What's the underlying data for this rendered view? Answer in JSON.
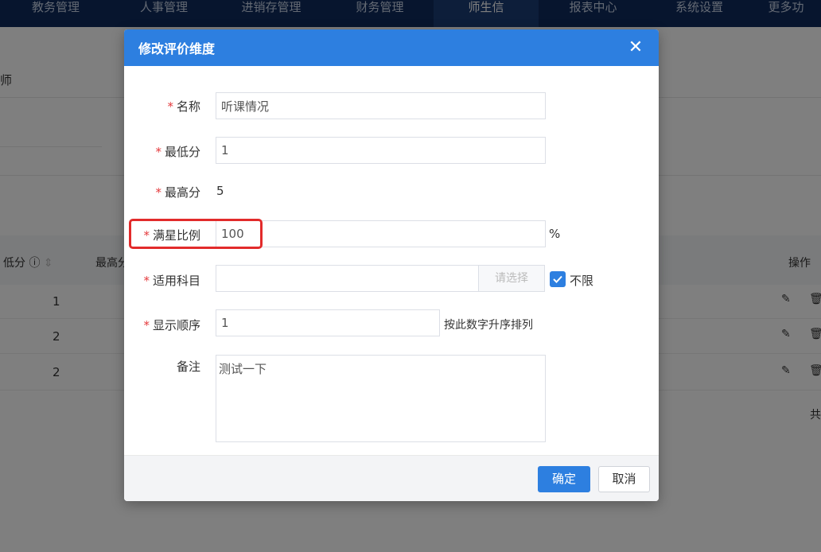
{
  "nav": {
    "items": [
      "教务管理",
      "人事管理",
      "进销存管理",
      "财务管理",
      "师生信",
      "报表中心",
      "系统设置",
      "更多功"
    ]
  },
  "background": {
    "teacher_label": "师",
    "table": {
      "col_min": "低分",
      "col_max": "最高分",
      "col_actions": "操作",
      "rows": [
        {
          "min": "1"
        },
        {
          "min": "2"
        },
        {
          "min": "2"
        }
      ],
      "total_prefix": "共"
    }
  },
  "modal": {
    "title": "修改评价维度",
    "required_mark": "*",
    "fields": {
      "name": {
        "label": "名称",
        "value": "听课情况"
      },
      "min_score": {
        "label": "最低分",
        "value": "1"
      },
      "max_score": {
        "label": "最高分",
        "value": "5"
      },
      "full_star_ratio": {
        "label": "满星比例",
        "value": "100",
        "suffix": "%"
      },
      "subject": {
        "label": "适用科目",
        "value": "",
        "select_label": "请选择",
        "unlimited_label": "不限",
        "unlimited_checked": true
      },
      "display_order": {
        "label": "显示顺序",
        "value": "1",
        "hint": "按此数字升序排列"
      },
      "remark": {
        "label": "备注",
        "value": "测试一下"
      }
    },
    "footer": {
      "confirm_label": "确定",
      "cancel_label": "取消"
    }
  },
  "colors": {
    "header_blue": "#2d7fe0",
    "required_red": "#e4393c",
    "highlight_red": "#e22b2b",
    "nav_bg": "#0e2a5c"
  }
}
